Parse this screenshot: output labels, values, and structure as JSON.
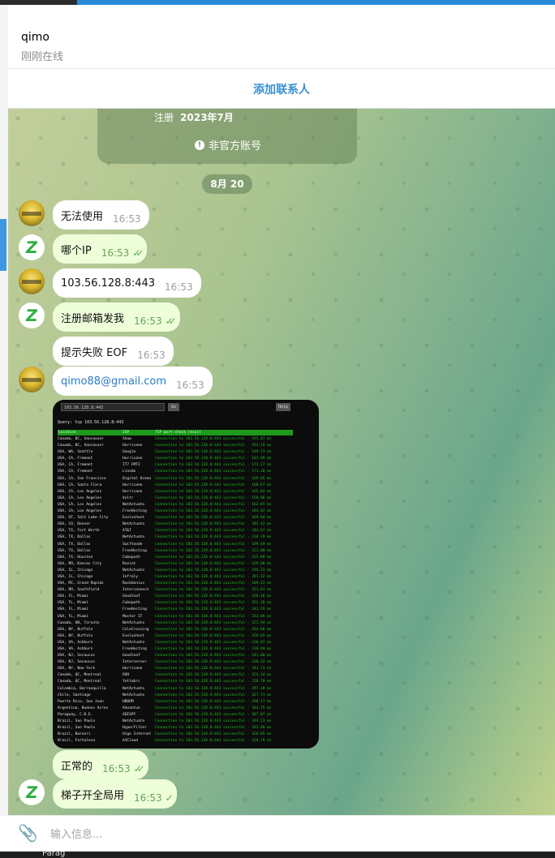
{
  "header": {
    "name": "qimo",
    "status": "刚刚在线"
  },
  "actions": {
    "add_contact": "添加联系人"
  },
  "info_card": {
    "register_label": "注册",
    "register_value": "2023年7月",
    "unofficial_label": "非官方账号"
  },
  "date_separator": "8月 20",
  "messages": [
    {
      "side": "in",
      "text": "无法使用",
      "time": "16:53"
    },
    {
      "side": "out",
      "text": "哪个IP",
      "time": "16:53",
      "ticks": "✓✓"
    },
    {
      "side": "in",
      "text": "103.56.128.8:443",
      "time": "16:53"
    },
    {
      "side": "out",
      "text": "注册邮箱发我",
      "time": "16:53",
      "ticks": "✓✓"
    },
    {
      "side": "in",
      "text": "提示失败  EOF",
      "time": "16:53"
    },
    {
      "side": "in",
      "text": "qimo88@gmail.com",
      "time": "16:53"
    },
    {
      "side": "out",
      "text": "正常的",
      "time": "16:53",
      "ticks": "✓✓"
    },
    {
      "side": "out",
      "text": "梯子开全局用",
      "time": "16:53",
      "ticks": "✓"
    }
  ],
  "screenshot": {
    "input_value": "103.56.128.8:443",
    "go_label": "Go",
    "help_label": "Help",
    "query": "Query: tcp 103.56.128.8:443",
    "columns": [
      "Location",
      "ISP",
      "TCP port check result"
    ],
    "rows": [
      [
        "Canada, BC, Vancouver",
        "Shaw",
        "Connection to 103.56.128.8:443 successful - 195.07 ms"
      ],
      [
        "Canada, BC, Vancouver",
        "Hurricane",
        "Connection to 103.56.128.8:443 successful - 191.19 ms"
      ],
      [
        "USA, WA, Seattle",
        "Google",
        "Connection to 103.56.128.8:443 successful - 149.73 ms"
      ],
      [
        "USA, CA, Fremont",
        "Hurricane",
        "Connection to 103.56.128.8:443 successful - 163.09 ms"
      ],
      [
        "USA, CA, Fremont",
        "IT7 FMT2",
        "Connection to 103.56.128.8:443 successful - 171.17 ms"
      ],
      [
        "USA, CA, Fremont",
        "Linode",
        "Connection to 103.56.128.8:443 successful - 171.20 ms"
      ],
      [
        "USA, CA, San Francisco",
        "Digital Ocean",
        "Connection to 103.56.128.8:443 successful - 169.05 ms"
      ],
      [
        "USA, CA, Santa Clara",
        "Hurricane",
        "Connection to 103.56.128.8:443 successful - 168.67 ms"
      ],
      [
        "USA, CA, Los Angeles",
        "Hurricane",
        "Connection to 103.56.128.8:443 successful - 165.02 ms"
      ],
      [
        "USA, CA, Los Angeles",
        "Vultr",
        "Connection to 103.56.128.8:443 successful - 158.06 ms"
      ],
      [
        "USA, CA, Los Angeles",
        "NetActuate",
        "Connection to 103.56.128.8:443 successful - 162.85 ms"
      ],
      [
        "USA, CA, Los Angeles",
        "FreeHosting",
        "Connection to 103.56.128.8:443 successful - 184.02 ms"
      ],
      [
        "USA, UT, Salt Lake City",
        "Evolushost",
        "Connection to 103.56.128.8:443 successful - 169.04 ms"
      ],
      [
        "USA, CO, Denver",
        "NetActuate",
        "Connection to 103.56.128.8:443 successful - 203.42 ms"
      ],
      [
        "USA, TX, Fort Worth",
        "AT&T",
        "Connection to 103.56.128.8:443 successful - 244.67 ms"
      ],
      [
        "USA, TX, Dallas",
        "NetActuate",
        "Connection to 103.56.128.8:443 successful - 218.19 ms"
      ],
      [
        "USA, TX, Dallas",
        "Swiftnode",
        "Connection to 103.56.128.8:443 successful - 199.69 ms"
      ],
      [
        "USA, TX, Dallas",
        "FreeHosting",
        "Connection to 103.56.128.8:443 successful - 221.00 ms"
      ],
      [
        "USA, TX, Houston",
        "Cubepath",
        "Connection to 103.56.128.8:443 successful - 225.09 ms"
      ],
      [
        "USA, MO, Kansas City",
        "Rozint",
        "Connection to 103.56.128.8:443 successful - 229.06 ms"
      ],
      [
        "USA, IL, Chicago",
        "NetActuate",
        "Connection to 103.56.128.8:443 successful - 194.23 ms"
      ],
      [
        "USA, IL, Chicago",
        "Infraly",
        "Connection to 103.56.128.8:443 successful - 201.32 ms"
      ],
      [
        "USA, MI, Grand Rapids",
        "RackGenius",
        "Connection to 103.56.128.8:443 successful - 189.22 ms"
      ],
      [
        "USA, MO, Southfield",
        "Interconnect",
        "Connection to 103.56.128.8:443 successful - 221.01 ms"
      ],
      [
        "USA, FL, Miami",
        "Goodleaf",
        "Connection to 103.56.128.8:443 successful - 236.16 ms"
      ],
      [
        "USA, FL, Miami",
        "Cubepath",
        "Connection to 103.56.128.8:443 successful - 252.38 ms"
      ],
      [
        "USA, FL, Miami",
        "FreeHosting",
        "Connection to 103.56.128.8:443 successful - 241.29 ms"
      ],
      [
        "USA, FL, Miami",
        "Master IT",
        "Connection to 103.56.128.8:443 successful - 233.06 ms"
      ],
      [
        "Canada, ON, Toronto",
        "NetActuate",
        "Connection to 103.56.128.8:443 successful - 221.94 ms"
      ],
      [
        "USA, NY, Buffalo",
        "ColoCrossing",
        "Connection to 103.56.128.8:443 successful - 264.06 ms"
      ],
      [
        "USA, NY, Buffalo",
        "Evolushost",
        "Connection to 103.56.128.8:443 successful - 258.05 ms"
      ],
      [
        "USA, VA, Ashburn",
        "NetActuate",
        "Connection to 103.56.128.8:443 successful - 230.07 ms"
      ],
      [
        "USA, VA, Ashburn",
        "FreeHosting",
        "Connection to 103.56.128.8:443 successful - 210.04 ms"
      ],
      [
        "USA, NJ, Secaucus",
        "Goodleaf",
        "Connection to 103.56.128.8:443 successful - 241.00 ms"
      ],
      [
        "USA, NJ, Secaucus",
        "Interserver",
        "Connection to 103.56.128.8:443 successful - 230.33 ms"
      ],
      [
        "USA, NY, New York",
        "Hurricane",
        "Connection to 103.56.128.8:443 successful - 243.73 ms"
      ],
      [
        "Canada, QC, Montreal",
        "OVH",
        "Connection to 103.56.128.8:443 successful - 224.14 ms"
      ],
      [
        "Canada, QC, Montreal",
        "Yottabrc",
        "Connection to 103.56.128.8:443 successful - 226.70 ms"
      ],
      [
        "Colombia, Barranquilla",
        "NetActuate",
        "Connection to 103.56.128.8:443 successful - 297.38 ms"
      ],
      [
        "Chile, Santiago",
        "NetActuate",
        "Connection to 103.56.128.8:443 successful - 327.71 ms"
      ],
      [
        "Puerto Rico, San Juan",
        "HBOOM",
        "Connection to 103.56.128.8:443 successful - 298.17 ms"
      ],
      [
        "Argentina, Buenos Aires",
        "Advantun",
        "Connection to 103.56.128.8:443 successful - 363.75 ms"
      ],
      [
        "Paraguay, C.D.E.",
        "ADISPY",
        "Connection to 103.56.128.8:443 successful - 387.07 ms"
      ],
      [
        "Brazil, Sao Paulo",
        "NetActuate",
        "Connection to 103.56.128.8:443 successful - 344.23 ms"
      ],
      [
        "Brazil, Sao Paulo",
        "HyperFilter",
        "Connection to 103.56.128.8:443 successful - 332.06 ms"
      ],
      [
        "Brazil, Barueri",
        "Higo Internet",
        "Connection to 103.56.128.8:443 successful - 328.05 ms"
      ],
      [
        "Brazil, Fortaleza",
        "A3Cloud",
        "Connection to 103.56.128.8:443 successful - 310.79 ms"
      ]
    ]
  },
  "composer": {
    "placeholder": "输入信息..."
  },
  "taskbar": {
    "start_label": "Parag"
  },
  "colors": {
    "accent": "#3a8fd0",
    "outgoing": "#eefed9",
    "incoming": "#ffffff",
    "tick": "#5fae4f",
    "terminal_ok": "#1fc01f"
  }
}
